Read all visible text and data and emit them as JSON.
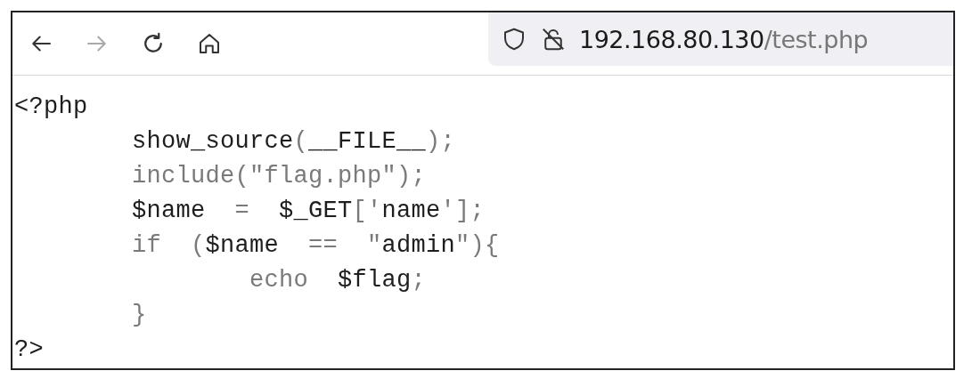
{
  "toolbar": {
    "back_disabled": false,
    "forward_disabled": true,
    "url_host": "192.168.80.130",
    "url_path": "/test.php"
  },
  "code_lines": [
    [
      {
        "kind": "default",
        "text": "<?php"
      }
    ],
    [
      {
        "kind": "default",
        "text": "        show_source"
      },
      {
        "kind": "keyword",
        "text": "("
      },
      {
        "kind": "default",
        "text": "__FILE__"
      },
      {
        "kind": "keyword",
        "text": ");"
      }
    ],
    [
      {
        "kind": "keyword",
        "text": "        include(\"flag.php\");"
      }
    ],
    [
      {
        "kind": "default",
        "text": "        $name"
      },
      {
        "kind": "keyword",
        "text": "  =  "
      },
      {
        "kind": "default",
        "text": "$_GET"
      },
      {
        "kind": "keyword",
        "text": "['"
      },
      {
        "kind": "default",
        "text": "name"
      },
      {
        "kind": "keyword",
        "text": "'];"
      }
    ],
    [
      {
        "kind": "keyword",
        "text": "        if  ("
      },
      {
        "kind": "default",
        "text": "$name"
      },
      {
        "kind": "keyword",
        "text": "  ==  \""
      },
      {
        "kind": "default",
        "text": "admin"
      },
      {
        "kind": "keyword",
        "text": "\"){"
      }
    ],
    [
      {
        "kind": "keyword",
        "text": "                echo  "
      },
      {
        "kind": "default",
        "text": "$flag"
      },
      {
        "kind": "keyword",
        "text": ";"
      }
    ],
    [
      {
        "kind": "keyword",
        "text": "        }"
      }
    ],
    [
      {
        "kind": "default",
        "text": "?>"
      }
    ]
  ]
}
